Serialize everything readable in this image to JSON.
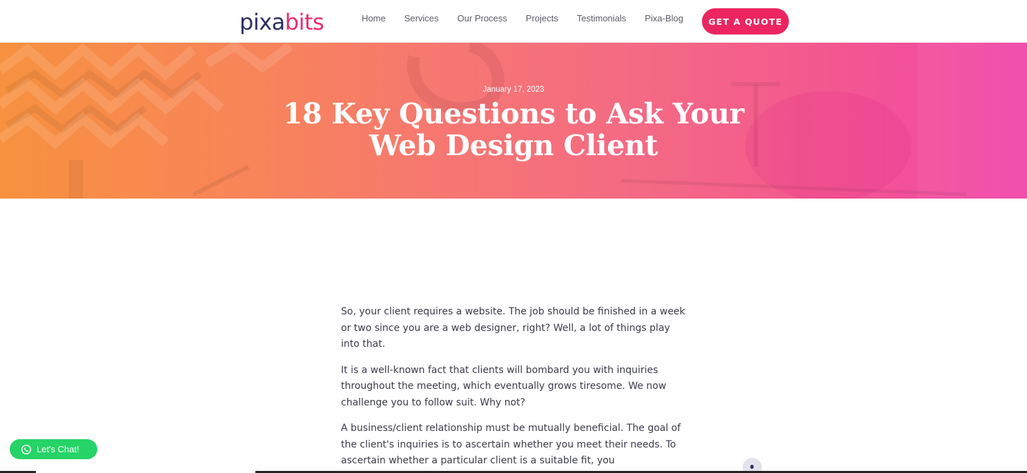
{
  "header": {
    "logo_part1": "pixa",
    "logo_part2": "bits",
    "nav": [
      "Home",
      "Services",
      "Our Process",
      "Projects",
      "Testimonials",
      "Pixa-Blog"
    ],
    "cta_label": "GET A QUOTE"
  },
  "hero": {
    "date": "January 17, 2023",
    "title_line1": "18 Key Questions to Ask Your",
    "title_line2": "Web Design Client"
  },
  "article": {
    "paragraphs": [
      "So, your client requires a website. The job should be finished in a week or two since you are a web designer, right? Well, a lot of things play into that.",
      "It is a well-known fact that clients will bombard you with inquiries throughout the meeting, which eventually grows tiresome. We now challenge you to follow suit. Why not?",
      "A business/client relationship must be mutually beneficial. The goal of the client's inquiries is to ascertain whether you meet their needs. To ascertain whether a particular client is a suitable fit, you"
    ]
  },
  "chat": {
    "label": "Let's Chat!",
    "icon": "whatsapp-icon"
  },
  "colors": {
    "brand_dark": "#2b2f5e",
    "brand_pink": "#ec2560",
    "chat_green": "#25d366"
  }
}
